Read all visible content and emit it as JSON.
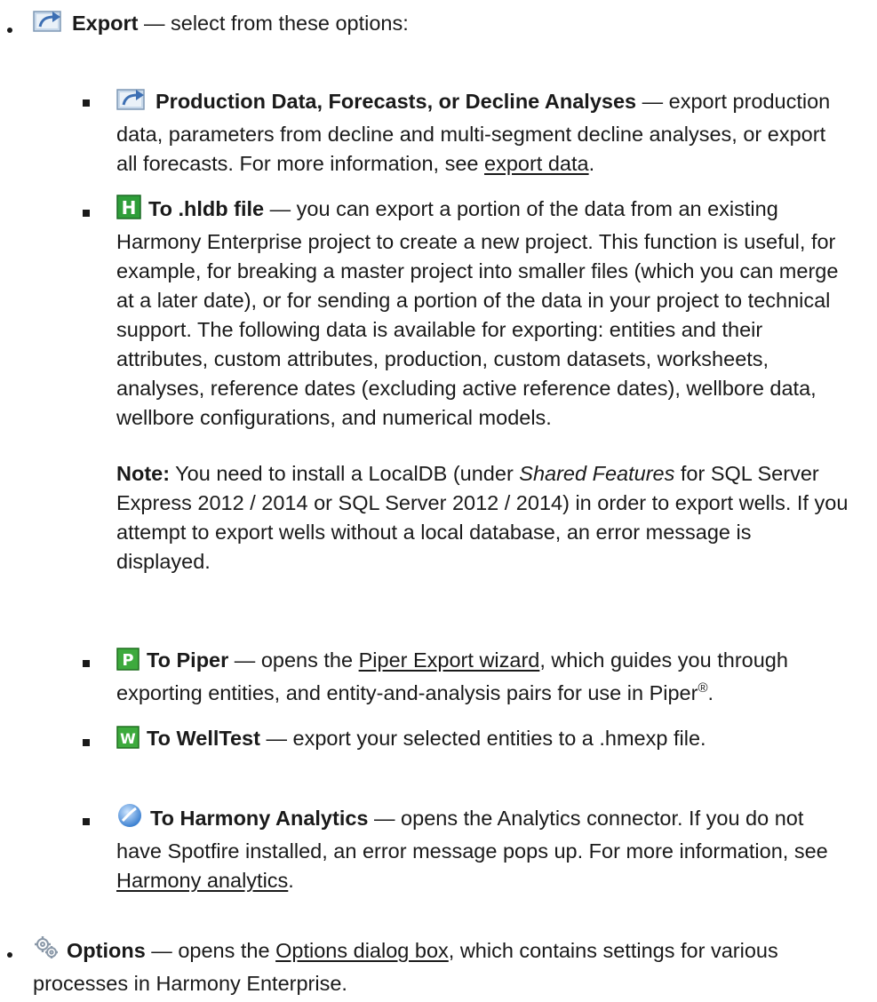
{
  "export": {
    "title": "Export",
    "desc": " — select from these options:",
    "icon": "export-icon",
    "items": [
      {
        "icon": "export-icon",
        "title": "Production Data, Forecasts, or Decline Analyses",
        "desc": " — export production data, parameters from decline and multi-segment decline analyses, or export all forecasts. For more information, see ",
        "link": "export data",
        "tail": "."
      },
      {
        "icon": "hldb-icon",
        "title": "To .hldb file",
        "desc": " — you can export a portion of the data from an existing Harmony Enterprise project to create a new project. This function is useful, for example, for breaking a master project into smaller files (which you can merge at a later date), or for sending a portion of the data in your project to technical support. The following data is available for exporting: entities and their attributes, custom attributes, production, custom datasets, worksheets, analyses, reference dates (excluding active reference dates), wellbore data, wellbore configurations, and numerical models.",
        "note_label": "Note:",
        "note_pre": " You need to install a LocalDB (under ",
        "note_italic": "Shared Features",
        "note_post": " for SQL Server Express 2012 / 2014 or SQL Server 2012 / 2014) in order to export wells. If you attempt to export wells without a local database, an error message is displayed."
      },
      {
        "icon": "piper-icon",
        "title": "To Piper",
        "desc": " — opens the ",
        "link": "Piper Export wizard",
        "tail": ", which guides you through exporting entities, and entity-and-analysis pairs for use in Piper",
        "sup": "®",
        "end": "."
      },
      {
        "icon": "welltest-icon",
        "title": "To WellTest",
        "desc": " — export your selected entities to a .hmexp file."
      },
      {
        "icon": "analytics-icon",
        "title": "To Harmony Analytics",
        "desc": " — opens the Analytics connector. If you do not have Spotfire installed, an error message pops up. For more information, see ",
        "link": "Harmony analytics",
        "tail": "."
      }
    ]
  },
  "options": {
    "icon": "gear-icon",
    "title": "Options",
    "desc": " — opens the ",
    "link": "Options dialog box",
    "tail": ", which contains settings for various processes in Harmony Enterprise."
  }
}
